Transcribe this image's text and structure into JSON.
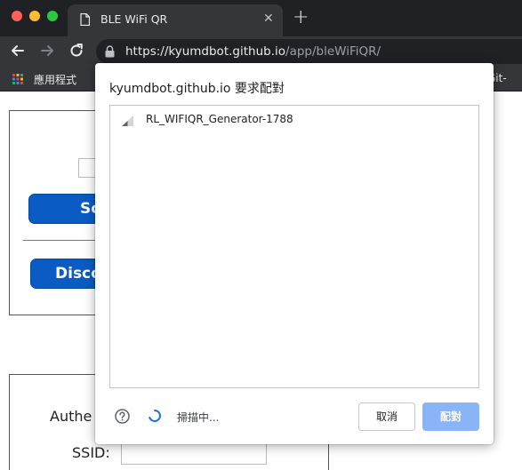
{
  "browser": {
    "tab_title": "BLE WiFi QR",
    "url_host": "https://kyumdbot.github.io",
    "url_path": "/app/bleWiFiQR/",
    "bookmarks": {
      "apps_label": "應用程式",
      "right_label": "Git-"
    }
  },
  "page": {
    "button_a_label": "Sc",
    "button_b_label": "Disco",
    "auth_label": "Authe",
    "ssid_label": "SSID:"
  },
  "chooser": {
    "title": "kyumdbot.github.io 要求配對",
    "devices": [
      {
        "name": "RL_WIFIQR_Generator-1788"
      }
    ],
    "status_text": "掃描中...",
    "cancel_label": "取消",
    "pair_label": "配對"
  },
  "colors": {
    "accent_blue": "#0a5bc4",
    "pair_button_disabled": "#8ab4f8",
    "chrome_dark": "#35363a"
  }
}
